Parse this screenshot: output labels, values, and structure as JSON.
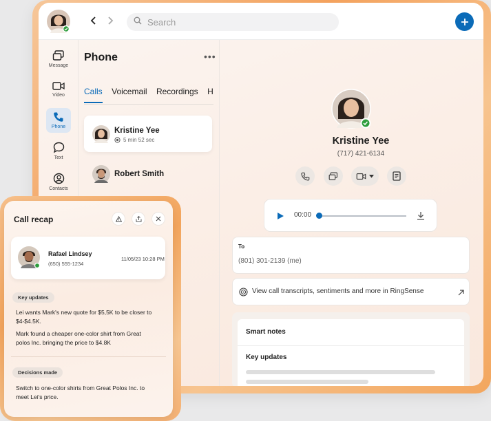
{
  "topbar": {
    "search_placeholder": "Search"
  },
  "sidebar": {
    "items": [
      {
        "label": "Message"
      },
      {
        "label": "Video"
      },
      {
        "label": "Phone"
      },
      {
        "label": "Text"
      },
      {
        "label": "Contacts"
      }
    ]
  },
  "list": {
    "title": "Phone",
    "more": "•••",
    "tabs": [
      {
        "label": "Calls"
      },
      {
        "label": "Voicemail"
      },
      {
        "label": "Recordings"
      },
      {
        "label": "Hud"
      }
    ],
    "calls": [
      {
        "name": "Kristine Yee",
        "duration": "5 min 52 sec"
      },
      {
        "name": "Robert Smith"
      }
    ]
  },
  "detail": {
    "name": "Kristine Yee",
    "phone": "(717) 421-6134",
    "player_time": "00:00",
    "to_label": "To",
    "to_value": "(801) 301-2139 (me)",
    "ringsense_text": "View call transcripts, sentiments and more in RingSense",
    "smart_notes_title": "Smart notes",
    "key_updates_label": "Key updates"
  },
  "recap": {
    "title": "Call recap",
    "contact_name": "Rafael Lindsey",
    "contact_phone": "(650) 555-1234",
    "contact_date": "11/05/23 10:28 PM",
    "key_updates_label": "Key updates",
    "update_1": "Lei wants Mark's new quote for $5,5K to be closer to $4-$4.5K.",
    "update_2": "Mark found a cheaper one-color shirt from Great polos Inc. bringing the price to $4.8K",
    "decisions_label": "Decisions made",
    "decision_1": "Switch to one-color shirts from Great Polos Inc. to meet Lei's price."
  },
  "colors": {
    "accent": "#0b6bb8",
    "online": "#2e9d3c",
    "frame": "#f4a25d"
  }
}
